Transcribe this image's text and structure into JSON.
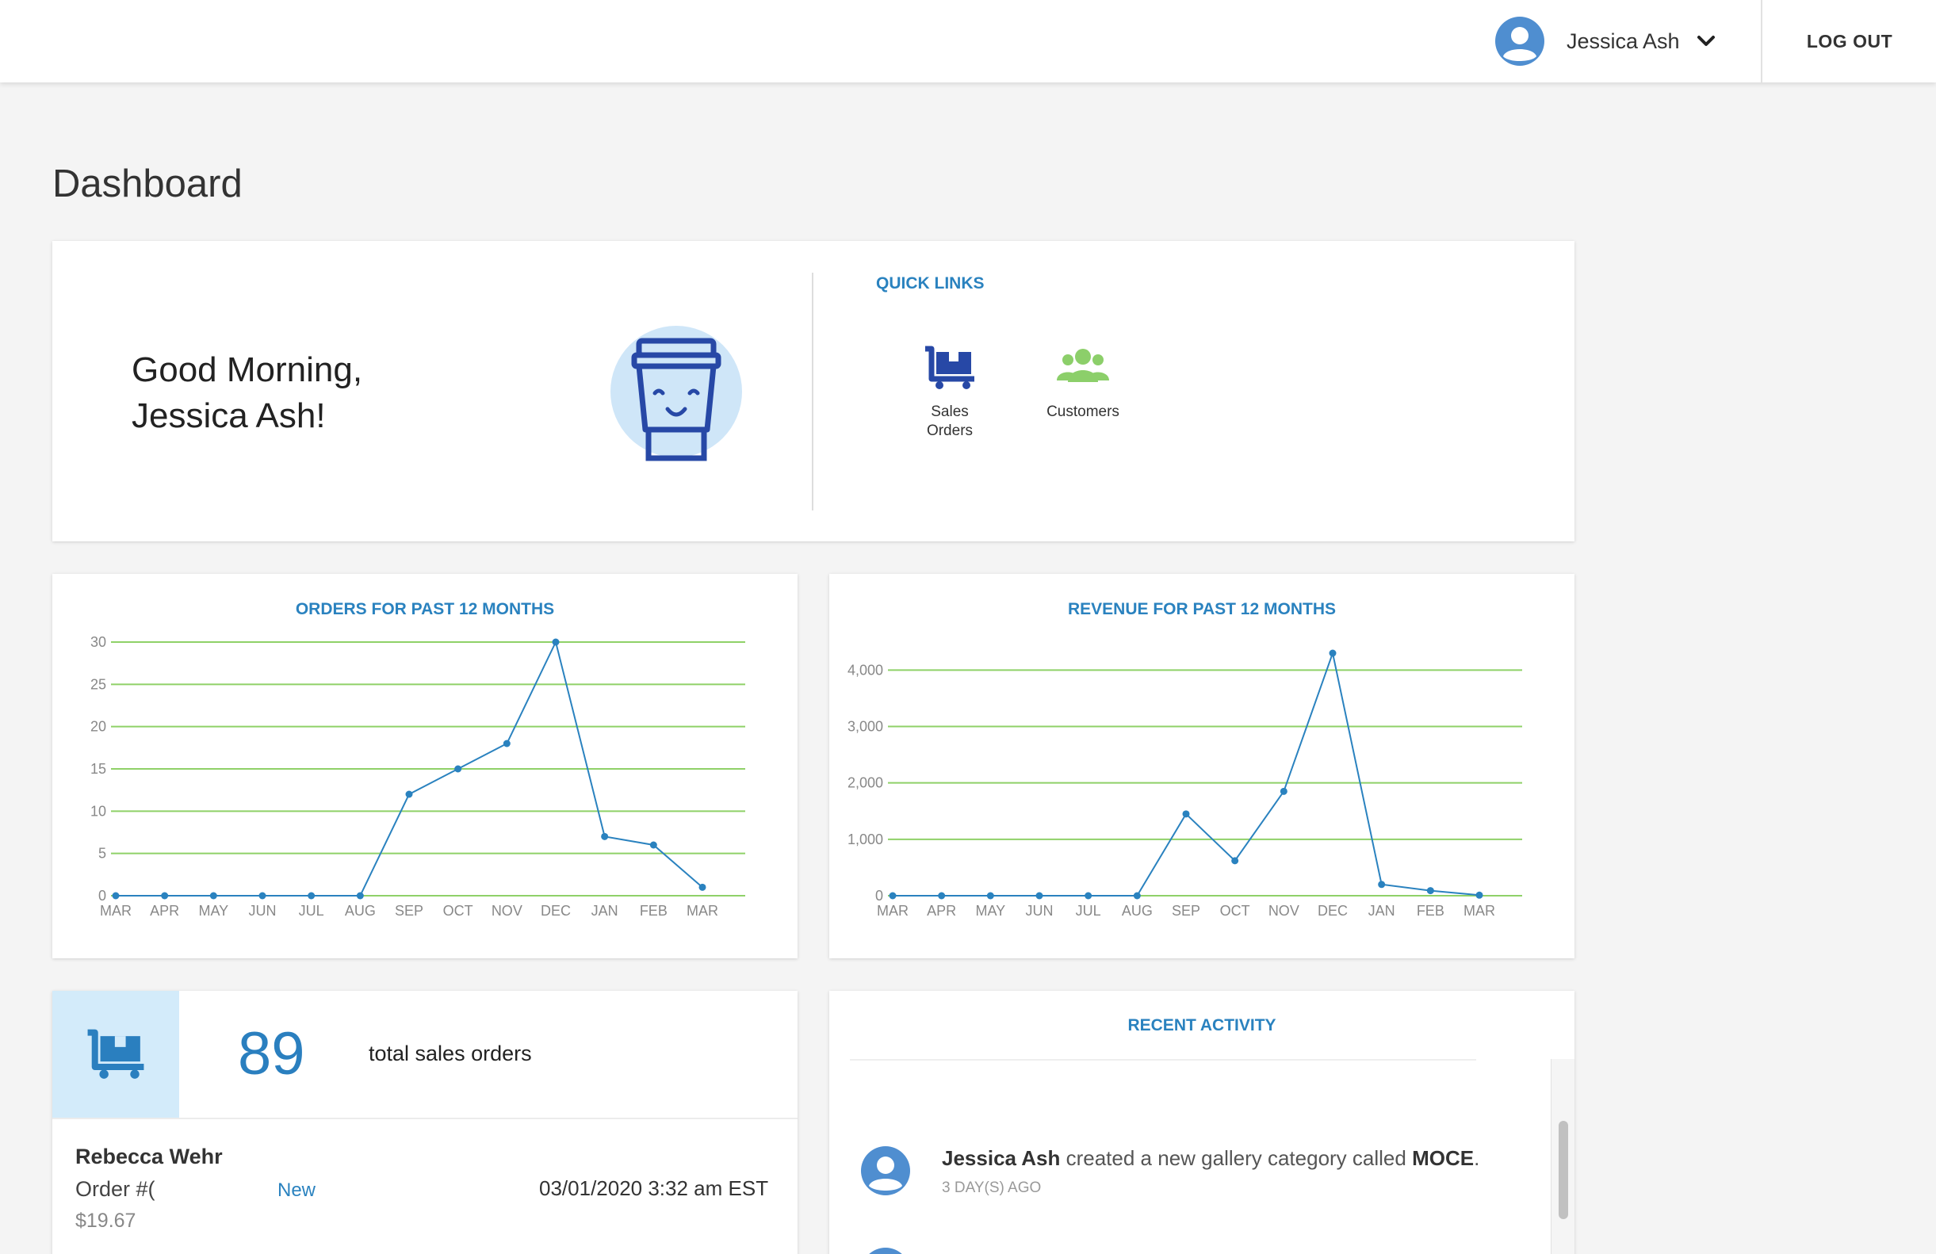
{
  "header": {
    "user_name": "Jessica Ash",
    "logout_label": "LOG OUT"
  },
  "page": {
    "title": "Dashboard"
  },
  "greeting": {
    "line1": "Good Morning,",
    "line2": "Jessica Ash!"
  },
  "quick_links": {
    "title": "QUICK LINKS",
    "items": [
      {
        "label_line1": "Sales",
        "label_line2": "Orders",
        "icon": "cart-icon"
      },
      {
        "label_line1": "Customers",
        "label_line2": "",
        "icon": "people-icon"
      }
    ]
  },
  "colors": {
    "accent": "#2a82bf",
    "grid": "#8fd168",
    "icon_blue": "#2748a6",
    "icon_green": "#8ccf6a"
  },
  "chart_data": [
    {
      "type": "line",
      "title": "ORDERS FOR PAST 12 MONTHS",
      "categories": [
        "MAR",
        "APR",
        "MAY",
        "JUN",
        "JUL",
        "AUG",
        "SEP",
        "OCT",
        "NOV",
        "DEC",
        "JAN",
        "FEB",
        "MAR"
      ],
      "values": [
        0,
        0,
        0,
        0,
        0,
        0,
        12,
        15,
        18,
        30,
        7,
        6,
        1
      ],
      "yticks": [
        0,
        5,
        10,
        15,
        20,
        25,
        30
      ],
      "ytick_labels": [
        "0",
        "5",
        "10",
        "15",
        "20",
        "25",
        "30"
      ],
      "ylim": [
        0,
        30
      ],
      "grid": true
    },
    {
      "type": "line",
      "title": "REVENUE FOR PAST 12 MONTHS",
      "categories": [
        "MAR",
        "APR",
        "MAY",
        "JUN",
        "JUL",
        "AUG",
        "SEP",
        "OCT",
        "NOV",
        "DEC",
        "JAN",
        "FEB",
        "MAR"
      ],
      "values": [
        0,
        0,
        0,
        0,
        0,
        0,
        1450,
        620,
        1850,
        4300,
        200,
        90,
        10
      ],
      "yticks": [
        0,
        1000,
        2000,
        3000,
        4000
      ],
      "ytick_labels": [
        "0",
        "1,000",
        "2,000",
        "3,000",
        "4,000"
      ],
      "ylim": [
        0,
        4300
      ],
      "grid": true
    }
  ],
  "sales_summary": {
    "count": "89",
    "label": "total sales orders",
    "order": {
      "customer": "Rebecca Wehr",
      "number_label": "Order #(",
      "status": "New",
      "date": "03/01/2020 3:32 am EST",
      "amount": "$19.67"
    }
  },
  "recent_activity": {
    "title": "RECENT ACTIVITY",
    "items": [
      {
        "actor": "Jessica Ash",
        "action": " created a new gallery category called ",
        "object": "MOCE",
        "suffix": ".",
        "time": "3 DAY(S) AGO"
      }
    ]
  }
}
